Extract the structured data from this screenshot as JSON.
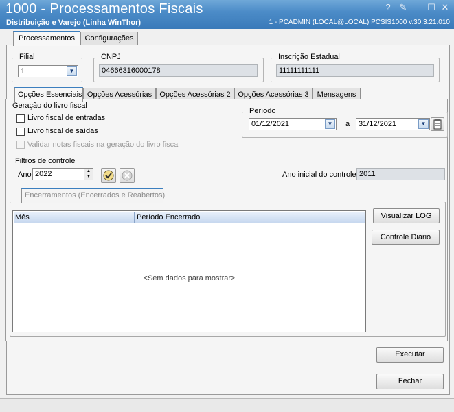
{
  "window": {
    "title": "1000 - Processamentos Fiscais",
    "subtitle": "Distribuição e Varejo (Linha WinThor)",
    "session_info": "1 - PCADMIN (LOCAL@LOCAL)   PCSIS1000  v.30.3.21.010",
    "controls": {
      "help": "?",
      "edit": "✎",
      "minimize": "—",
      "maximize": "☐",
      "close": "✕"
    }
  },
  "outer_tabs": [
    {
      "label": "Processamentos",
      "active": true
    },
    {
      "label": "Configurações",
      "active": false
    }
  ],
  "header": {
    "filial_label": "Filial",
    "filial_value": "1",
    "cnpj_label": "CNPJ",
    "cnpj_value": "04666316000178",
    "ie_label": "Inscrição Estadual",
    "ie_value": "11111111111"
  },
  "inner_tabs": [
    {
      "label": "Opções Essenciais",
      "active": true
    },
    {
      "label": "Opções Acessórias",
      "active": false
    },
    {
      "label": "Opções Acessórias 2",
      "active": false
    },
    {
      "label": "Opções Acessórias 3",
      "active": false
    },
    {
      "label": "Mensagens",
      "active": false
    }
  ],
  "geracao": {
    "title": "Geração do livro fiscal",
    "option1": "Livro fiscal de entradas",
    "option2": "Livro fiscal de saídas",
    "option3": "Validar notas fiscais na geração do livro fiscal"
  },
  "periodo": {
    "label": "Período",
    "start": "01/12/2021",
    "separator": "a",
    "end": "31/12/2021"
  },
  "filtros": {
    "title": "Filtros de controle",
    "ano_label": "Ano",
    "ano_value": "2022",
    "ano_inicial_label": "Ano inicial do controle",
    "ano_inicial_value": "2011"
  },
  "encerramentos": {
    "tab_label": "Encerramentos (Encerrados e Reabertos)",
    "columns": [
      "Mês",
      "Período Encerrado"
    ],
    "empty_text": "<Sem dados para mostrar>"
  },
  "buttons": {
    "visualizar_log": "Visualizar LOG",
    "controle_diario": "Controle Diário",
    "executar": "Executar",
    "fechar": "Fechar"
  }
}
